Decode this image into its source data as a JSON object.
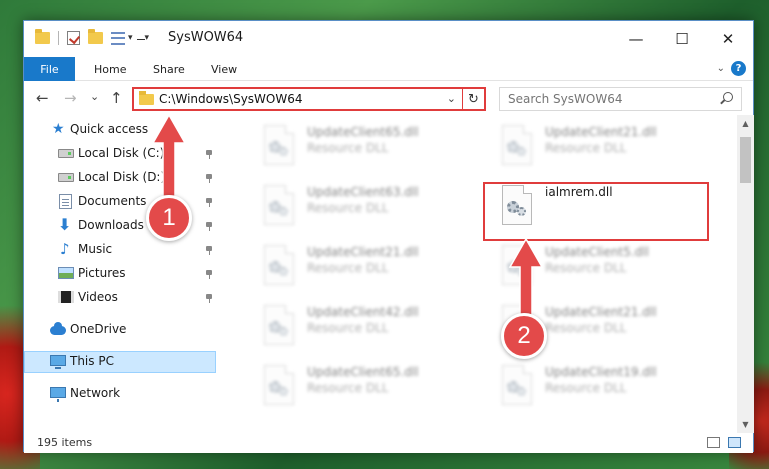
{
  "window": {
    "title": "SysWOW64",
    "minimize_glyph": "—",
    "maximize_glyph": "☐",
    "close_glyph": "✕"
  },
  "ribbon": {
    "tabs": [
      {
        "label": "File"
      },
      {
        "label": "Home"
      },
      {
        "label": "Share"
      },
      {
        "label": "View"
      }
    ],
    "help_glyph": "?"
  },
  "navbar": {
    "back_glyph": "←",
    "forward_glyph": "→",
    "recent_glyph": "⌄",
    "up_glyph": "↑",
    "address": "C:\\Windows\\SysWOW64",
    "refresh_glyph": "↻",
    "search_placeholder": "Search SysWOW64"
  },
  "sidebar": {
    "items": [
      {
        "label": "Quick access",
        "icon": "star-icon",
        "pinned": false
      },
      {
        "label": "Local Disk (C:)",
        "icon": "drive-icon",
        "pinned": true
      },
      {
        "label": "Local Disk (D:)",
        "icon": "drive-icon",
        "pinned": true
      },
      {
        "label": "Documents",
        "icon": "documents-icon",
        "pinned": true
      },
      {
        "label": "Downloads",
        "icon": "downloads-icon",
        "pinned": true
      },
      {
        "label": "Music",
        "icon": "music-icon",
        "pinned": true
      },
      {
        "label": "Pictures",
        "icon": "pictures-icon",
        "pinned": true
      },
      {
        "label": "Videos",
        "icon": "videos-icon",
        "pinned": true
      },
      {
        "label": "OneDrive",
        "icon": "onedrive-icon",
        "pinned": false
      },
      {
        "label": "This PC",
        "icon": "this-pc-icon",
        "pinned": false,
        "selected": true
      },
      {
        "label": "Network",
        "icon": "network-icon",
        "pinned": false
      }
    ]
  },
  "files": {
    "col1": [
      {
        "name": "UpdateClient65.dll",
        "type": "Resource DLL"
      },
      {
        "name": "UpdateClient63.dll",
        "type": "Resource DLL"
      },
      {
        "name": "UpdateClient21.dll",
        "type": "Resource DLL"
      },
      {
        "name": "UpdateClient42.dll",
        "type": "Resource DLL"
      },
      {
        "name": "UpdateClient65.dll",
        "type": "Resource DLL"
      }
    ],
    "col2": [
      {
        "name": "UpdateClient21.dll",
        "type": "Resource DLL"
      },
      {
        "name": "ialmrem.dll",
        "type": "",
        "highlighted": true
      },
      {
        "name": "UpdateClient5.dll",
        "type": "Resource DLL"
      },
      {
        "name": "UpdateClient21.dll",
        "type": "Resource DLL"
      },
      {
        "name": "UpdateClient19.dll",
        "type": "Resource DLL"
      }
    ]
  },
  "status": {
    "item_count": "195 items"
  },
  "callouts": {
    "step1": "1",
    "step2": "2",
    "color": "#e34a4a"
  }
}
